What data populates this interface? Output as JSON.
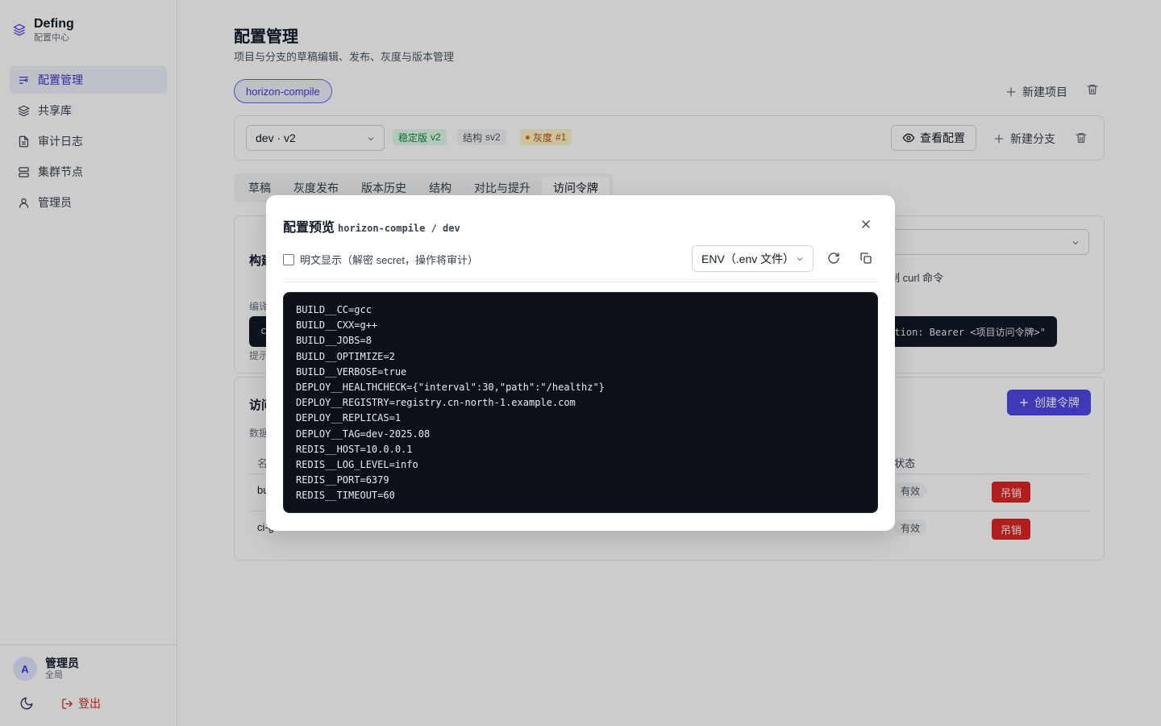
{
  "brand": {
    "title": "Defing",
    "subtitle": "配置中心"
  },
  "sidebar": {
    "items": [
      {
        "label": "配置管理",
        "icon": "sliders-icon",
        "active": true
      },
      {
        "label": "共享库",
        "icon": "layers-icon"
      },
      {
        "label": "审计日志",
        "icon": "file-text-icon"
      },
      {
        "label": "集群节点",
        "icon": "server-icon"
      },
      {
        "label": "管理员",
        "icon": "user-icon"
      }
    ],
    "user": {
      "initial": "A",
      "name": "管理员",
      "role": "全局"
    },
    "logout_label": "登出"
  },
  "page": {
    "title": "配置管理",
    "subtitle": "项目与分支的草稿编辑、发布、灰度与版本管理",
    "project": "horizon-compile",
    "new_project_label": "新建项目"
  },
  "branch": {
    "selected": "dev · v2",
    "badges": {
      "stable_label": "稳定版",
      "stable_version": "v2",
      "schema_label": "结构",
      "schema_version": "sv2",
      "gray_label": "灰度",
      "gray_number": "#1"
    },
    "view_config_label": "查看配置",
    "new_branch_label": "新建分支"
  },
  "tabs": [
    "草稿",
    "灰度发布",
    "版本历史",
    "结构",
    "对比与提升",
    "访问令牌"
  ],
  "active_tab": "访问令牌",
  "build_card": {
    "title_fragment": "构建",
    "curl_fragment": "制 curl 命令",
    "label_fragment": "编译",
    "code_start": "c",
    "code_end": "tion: Bearer <项目访问令牌>\"",
    "hint_fragment": "提示"
  },
  "tokens_card": {
    "title_fragment": "访问",
    "desc_fragment": "数据",
    "create_label": "创建令牌",
    "col_name_fragment": "名",
    "col_status": "状态",
    "rows": [
      {
        "name_fragment": "bu",
        "status": "有效",
        "action": "吊销"
      },
      {
        "name_fragment": "ci-g",
        "status": "有效",
        "action": "吊销"
      }
    ]
  },
  "modal": {
    "title": "配置预览",
    "path": "horizon-compile / dev",
    "plaintext_label": "明文显示（解密 secret，操作将审计）",
    "format_selected": "ENV（.env 文件）",
    "lines": [
      "BUILD__CC=gcc",
      "BUILD__CXX=g++",
      "BUILD__JOBS=8",
      "BUILD__OPTIMIZE=2",
      "BUILD__VERBOSE=true",
      "DEPLOY__HEALTHCHECK={\"interval\":30,\"path\":\"/healthz\"}",
      "DEPLOY__REGISTRY=registry.cn-north-1.example.com",
      "DEPLOY__REPLICAS=1",
      "DEPLOY__TAG=dev-2025.08",
      "REDIS__HOST=10.0.0.1",
      "REDIS__LOG_LEVEL=info",
      "REDIS__PORT=6379",
      "REDIS__TIMEOUT=60"
    ]
  }
}
